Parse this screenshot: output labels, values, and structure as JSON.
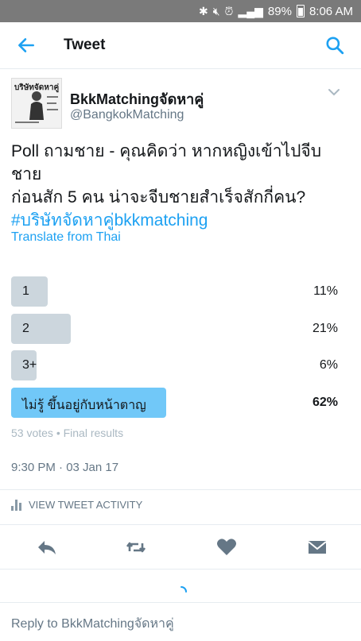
{
  "status_bar": {
    "battery": "89%",
    "time": "8:06 AM"
  },
  "header": {
    "title": "Tweet"
  },
  "tweet": {
    "author_name": "BkkMatchingจัดหาคู่",
    "author_handle": "@BangkokMatching",
    "avatar_text": "บริษัทจัดหาคู่",
    "text_line1": "Poll ถามชาย - คุณคิดว่า หากหญิงเข้าไปจีบชาย",
    "text_line2": "ก่อนสัก 5 คน น่าจะจีบชายสำเร็จสักกี่คน?",
    "hashtag": "#บริษัทจัดหาคู่bkkmatching",
    "translate_label": "Translate from Thai",
    "timestamp": "9:30 PM · 03 Jan 17",
    "view_activity_label": "VIEW TWEET ACTIVITY"
  },
  "poll": {
    "options": [
      {
        "label": "1",
        "percent": "11%",
        "fraction": 0.11
      },
      {
        "label": "2",
        "percent": "21%",
        "fraction": 0.21
      },
      {
        "label": "3+",
        "percent": "6%",
        "fraction": 0.06
      },
      {
        "label": "ไม่รู้ ขึ้นอยู่กับหน้าตาญ",
        "percent": "62%",
        "fraction": 0.62
      }
    ],
    "meta": "53 votes • Final results"
  },
  "reply": {
    "placeholder": "Reply to BkkMatchingจัดหาคู่"
  },
  "colors": {
    "accent": "#1da1f2",
    "poll_bar": "#ccd6dd",
    "poll_winner": "#71c8f8",
    "status_bar": "#7a7a7a"
  },
  "icons": {
    "back": "arrow-left-icon",
    "search": "search-icon",
    "caret": "chevron-down-icon",
    "reply": "reply-icon",
    "retweet": "retweet-icon",
    "like": "heart-icon",
    "dm": "envelope-icon"
  }
}
